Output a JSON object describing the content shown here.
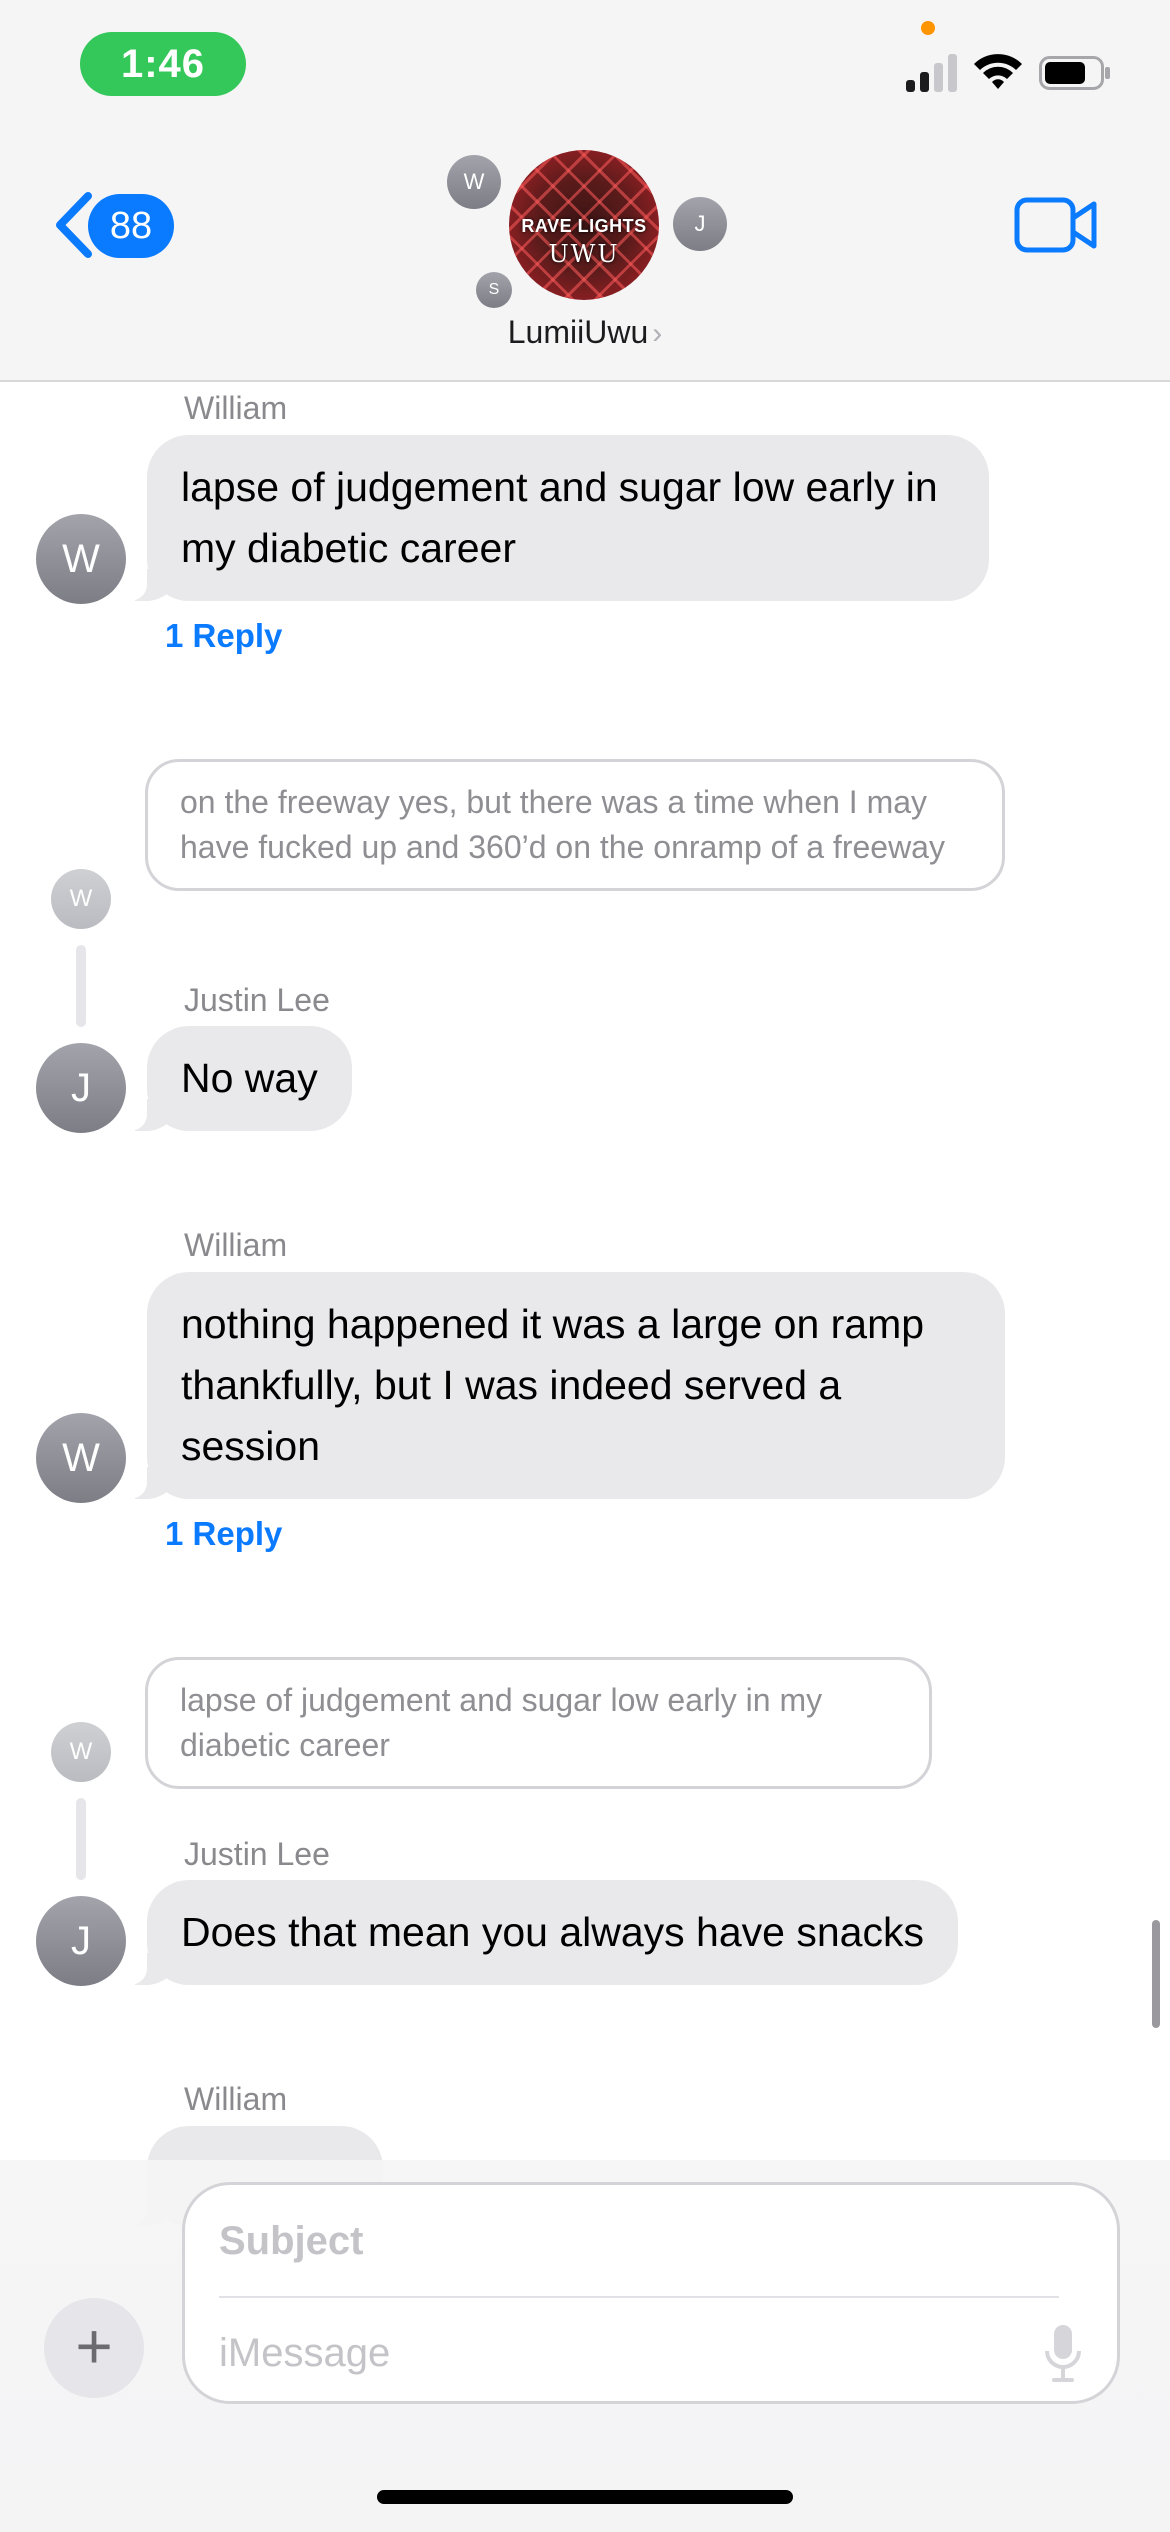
{
  "status_bar": {
    "time": "1:46",
    "time_pill_color": "#34c759",
    "icons": [
      "cellular-signal-icon",
      "wifi-icon",
      "battery-icon"
    ]
  },
  "header": {
    "back_badge_count": "88",
    "group_name": "LumiiUwu",
    "group_avatar_text_top": "RAVE LIGHTS",
    "group_avatar_text_bottom": "UWU",
    "member_initials": [
      "W",
      "J",
      "S"
    ],
    "video_icon": "video-camera-icon",
    "accent_color": "#0a7aff"
  },
  "messages": [
    {
      "sender": "William",
      "initial": "W",
      "text": "lapse of judgement and sugar low early in my diabetic career",
      "reply_label": "1 Reply"
    },
    {
      "quoted_initial": "W",
      "quote": "on the freeway yes, but there was a time when I may have fucked up and 360’d on the onramp of a freeway",
      "sender": "Justin Lee",
      "initial": "J",
      "text": "No way"
    },
    {
      "sender": "William",
      "initial": "W",
      "text": "nothing happened it was a large on ramp thankfully, but I was indeed served a session",
      "reply_label": "1 Reply"
    },
    {
      "quoted_initial": "W",
      "quote": "lapse of judgement and sugar low early in my diabetic career",
      "sender": "Justin Lee",
      "initial": "J",
      "text": "Does that mean you always have snacks"
    },
    {
      "sender": "William"
    }
  ],
  "composer": {
    "subject_placeholder": "Subject",
    "message_placeholder": "iMessage",
    "plus_label": "+"
  }
}
